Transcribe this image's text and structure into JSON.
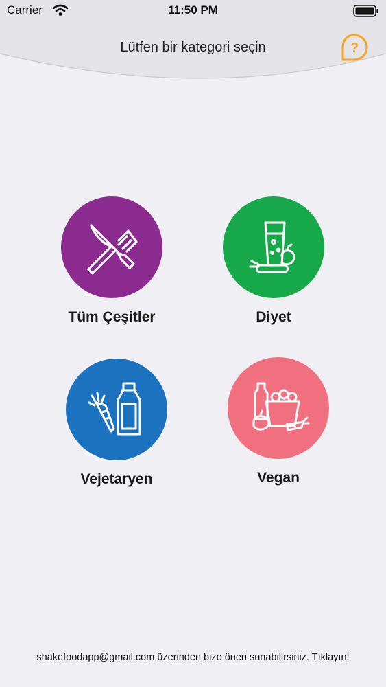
{
  "status_bar": {
    "carrier": "Carrier",
    "time": "11:50 PM"
  },
  "header": {
    "title": "Lütfen bir kategori seçin",
    "help_label": "?"
  },
  "colors": {
    "accent": "#f5a623",
    "purple": "#8b2a8f",
    "green": "#17a84a",
    "blue": "#1b72bf",
    "pink": "#f07080"
  },
  "categories": [
    {
      "label": "Tüm Çeşitler",
      "icon": "fork-knife-icon"
    },
    {
      "label": "Diyet",
      "icon": "juice-glass-icon"
    },
    {
      "label": "Vejetaryen",
      "icon": "milk-carrot-icon"
    },
    {
      "label": "Vegan",
      "icon": "grocery-bag-icon"
    }
  ],
  "footer": {
    "text": "shakefoodapp@gmail.com üzerinden bize öneri sunabilirsiniz. Tıklayın!"
  }
}
